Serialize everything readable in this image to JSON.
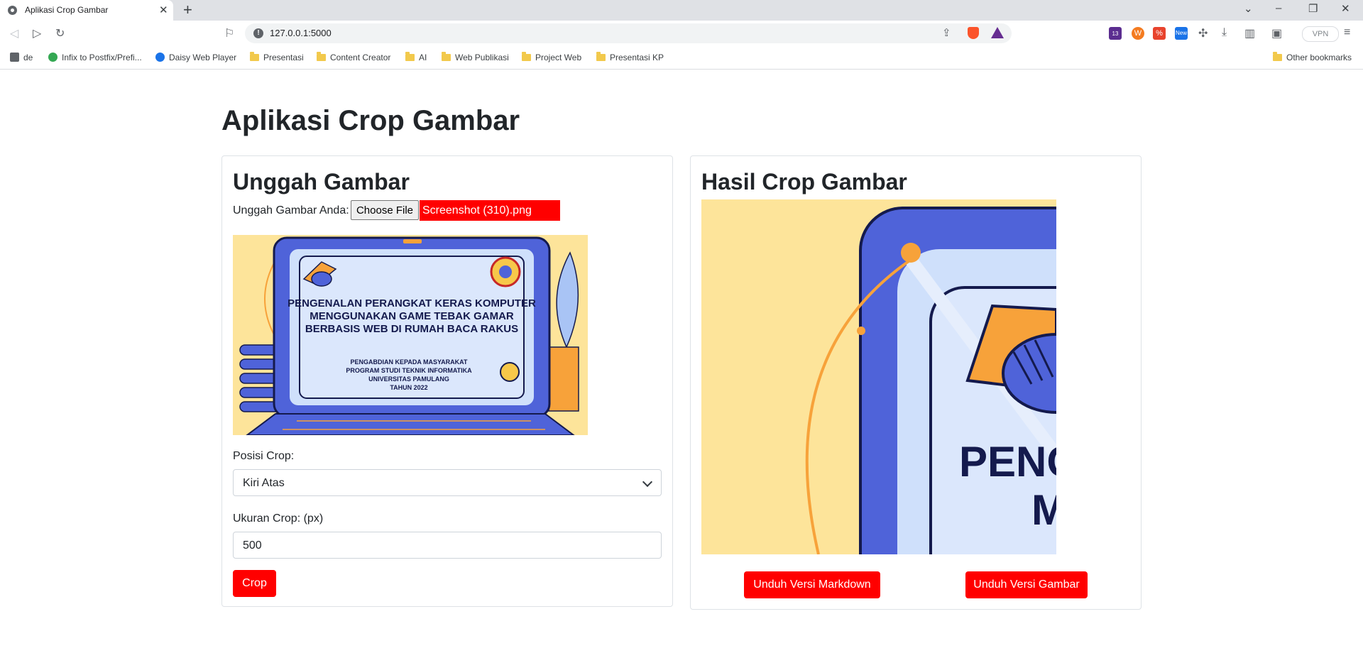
{
  "browser": {
    "tab_title": "Aplikasi Crop Gambar",
    "url": "127.0.0.1:5000",
    "vpn_label": "VPN",
    "ext_badge": "13",
    "ext_new": "New",
    "bookmarks": [
      {
        "label": "de",
        "icon": "apps-grid-icon"
      },
      {
        "label": "Infix to Postfix/Prefi...",
        "icon": "site-favicon"
      },
      {
        "label": "Daisy Web Player",
        "icon": "site-favicon"
      },
      {
        "label": "Presentasi",
        "icon": "folder-icon"
      },
      {
        "label": "Content Creator",
        "icon": "folder-icon"
      },
      {
        "label": "AI",
        "icon": "folder-icon"
      },
      {
        "label": "Web Publikasi",
        "icon": "folder-icon"
      },
      {
        "label": "Project Web",
        "icon": "folder-icon"
      },
      {
        "label": "Presentasi KP",
        "icon": "folder-icon"
      }
    ],
    "other_bookmarks": "Other bookmarks"
  },
  "page": {
    "title": "Aplikasi Crop Gambar",
    "accent_color": "#ff0000",
    "upload": {
      "heading": "Unggah Gambar",
      "label": "Unggah Gambar Anda:",
      "choose_file": "Choose File",
      "file_name": "Screenshot (310).png",
      "preview": {
        "line1": "PENGENALAN PERANGKAT KERAS KOMPUTER",
        "line2": "MENGGUNAKAN GAME TEBAK GAMAR",
        "line3": "BERBASIS WEB DI RUMAH BACA RAKUS",
        "sub1": "PENGABDIAN KEPADA MASYARAKAT",
        "sub2": "PROGRAM STUDI TEKNIK INFORMATIKA",
        "sub3": "UNIVERSITAS PAMULANG",
        "sub4": "TAHUN 2022"
      },
      "position_label": "Posisi Crop:",
      "position_value": "Kiri Atas",
      "size_label": "Ukuran Crop: (px)",
      "size_value": "500",
      "crop_button": "Crop"
    },
    "result": {
      "heading": "Hasil Crop Gambar",
      "crop_text1": "PENG",
      "crop_text2": "M",
      "download_markdown": "Unduh Versi Markdown",
      "download_image": "Unduh Versi Gambar"
    }
  }
}
